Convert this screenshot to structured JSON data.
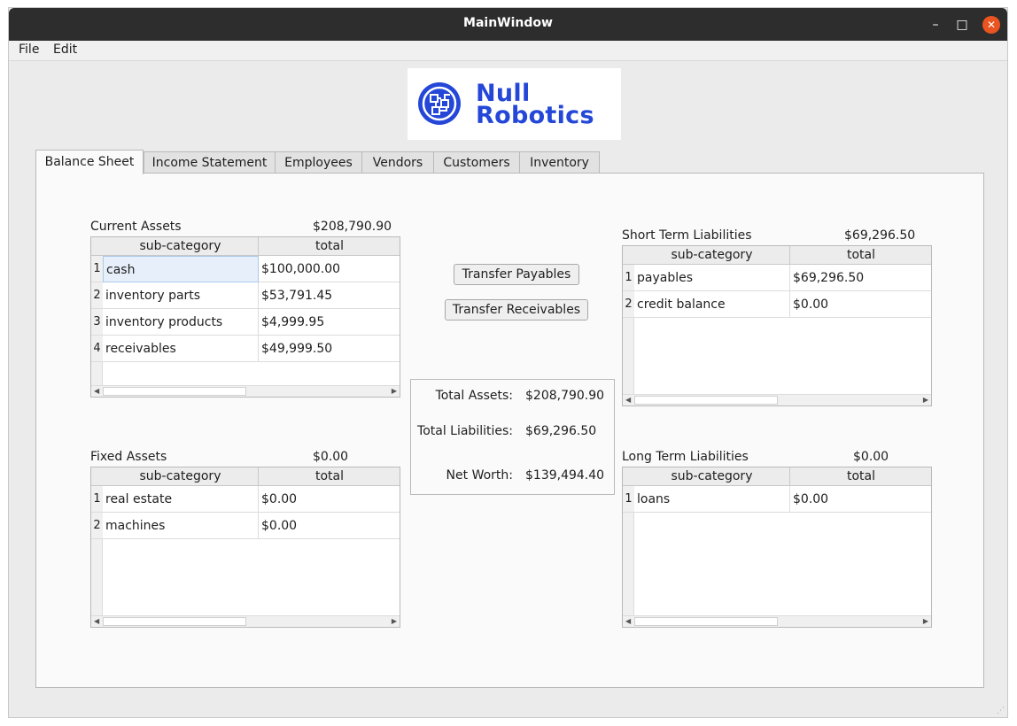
{
  "window": {
    "title": "MainWindow",
    "min_glyph": "–",
    "max_glyph": "□",
    "close_glyph": "✕"
  },
  "menu": {
    "file": "File",
    "edit": "Edit"
  },
  "logo": {
    "line1": "Null",
    "line2": "Robotics"
  },
  "tabs": [
    {
      "label": "Balance Sheet"
    },
    {
      "label": "Income Statement"
    },
    {
      "label": "Employees"
    },
    {
      "label": "Vendors"
    },
    {
      "label": "Customers"
    },
    {
      "label": "Inventory"
    }
  ],
  "columns": {
    "sub": "sub-category",
    "total": "total"
  },
  "current_assets": {
    "label": "Current Assets",
    "total": "$208,790.90",
    "rows": [
      {
        "n": "1",
        "name": "cash",
        "total": "$100,000.00"
      },
      {
        "n": "2",
        "name": "inventory parts",
        "total": "$53,791.45"
      },
      {
        "n": "3",
        "name": "inventory products",
        "total": "$4,999.95"
      },
      {
        "n": "4",
        "name": "receivables",
        "total": "$49,999.50"
      }
    ]
  },
  "fixed_assets": {
    "label": "Fixed Assets",
    "total": "$0.00",
    "rows": [
      {
        "n": "1",
        "name": "real estate",
        "total": "$0.00"
      },
      {
        "n": "2",
        "name": "machines",
        "total": "$0.00"
      }
    ]
  },
  "short_term_liabilities": {
    "label": "Short Term Liabilities",
    "total": "$69,296.50",
    "rows": [
      {
        "n": "1",
        "name": "payables",
        "total": "$69,296.50"
      },
      {
        "n": "2",
        "name": "credit balance",
        "total": "$0.00"
      }
    ]
  },
  "long_term_liabilities": {
    "label": "Long Term Liabilities",
    "total": "$0.00",
    "rows": [
      {
        "n": "1",
        "name": "loans",
        "total": "$0.00"
      }
    ]
  },
  "buttons": {
    "transfer_payables": "Transfer Payables",
    "transfer_receivables": "Transfer Receivables"
  },
  "summary": {
    "assets_label": "Total Assets:",
    "assets_value": "$208,790.90",
    "liabilities_label": "Total Liabilities:",
    "liabilities_value": "$69,296.50",
    "networth_label": "Net Worth:",
    "networth_value": "$139,494.40"
  },
  "colors": {
    "brand": "#2447d8",
    "close_button": "#e95420",
    "titlebar": "#2d2d2d"
  }
}
